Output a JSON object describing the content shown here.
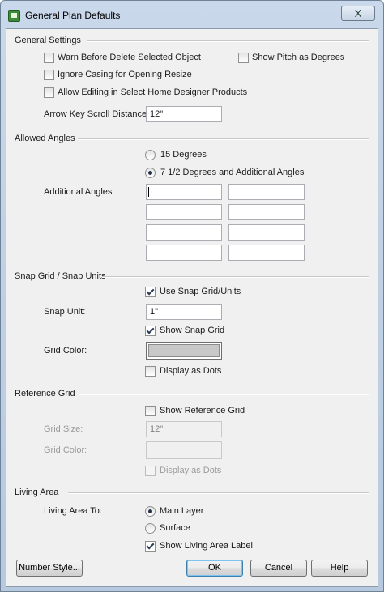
{
  "window": {
    "title": "General Plan Defaults",
    "close_label": "X"
  },
  "general": {
    "header": "General Settings",
    "warn_before_delete": {
      "label": "Warn Before Delete Selected Object",
      "checked": false
    },
    "show_pitch": {
      "label": "Show Pitch as Degrees",
      "checked": false
    },
    "ignore_casing": {
      "label": "Ignore Casing for Opening Resize",
      "checked": false
    },
    "allow_editing": {
      "label": "Allow Editing in Select Home Designer Products",
      "checked": false
    },
    "arrow_key_label": "Arrow Key Scroll Distance:",
    "arrow_key_value": "12\""
  },
  "angles": {
    "header": "Allowed Angles",
    "option_15": {
      "label": "15 Degrees",
      "selected": false
    },
    "option_7_5": {
      "label": "7 1/2 Degrees and Additional Angles",
      "selected": true
    },
    "additional_label": "Additional Angles:",
    "additional_values": [
      "",
      "",
      "",
      "",
      "",
      "",
      "",
      ""
    ]
  },
  "snap": {
    "header": "Snap Grid / Snap Units",
    "use_snap": {
      "label": "Use Snap Grid/Units",
      "checked": true
    },
    "snap_unit_label": "Snap Unit:",
    "snap_unit_value": "1\"",
    "show_snap_grid": {
      "label": "Show Snap Grid",
      "checked": true
    },
    "grid_color_label": "Grid Color:",
    "grid_color": "#c8c8c8",
    "display_dots": {
      "label": "Display as Dots",
      "checked": false
    }
  },
  "reference": {
    "header": "Reference Grid",
    "show_reference": {
      "label": "Show Reference Grid",
      "checked": false
    },
    "grid_size_label": "Grid Size:",
    "grid_size_value": "12\"",
    "grid_color_label": "Grid Color:",
    "display_dots": {
      "label": "Display as Dots",
      "checked": false
    }
  },
  "living": {
    "header": "Living Area",
    "living_area_to_label": "Living Area To:",
    "main_layer": {
      "label": "Main Layer",
      "selected": true
    },
    "surface": {
      "label": "Surface",
      "selected": false
    },
    "show_label": {
      "label": "Show Living Area Label",
      "checked": true
    }
  },
  "buttons": {
    "number_style": "Number Style...",
    "ok": "OK",
    "cancel": "Cancel",
    "help": "Help"
  }
}
